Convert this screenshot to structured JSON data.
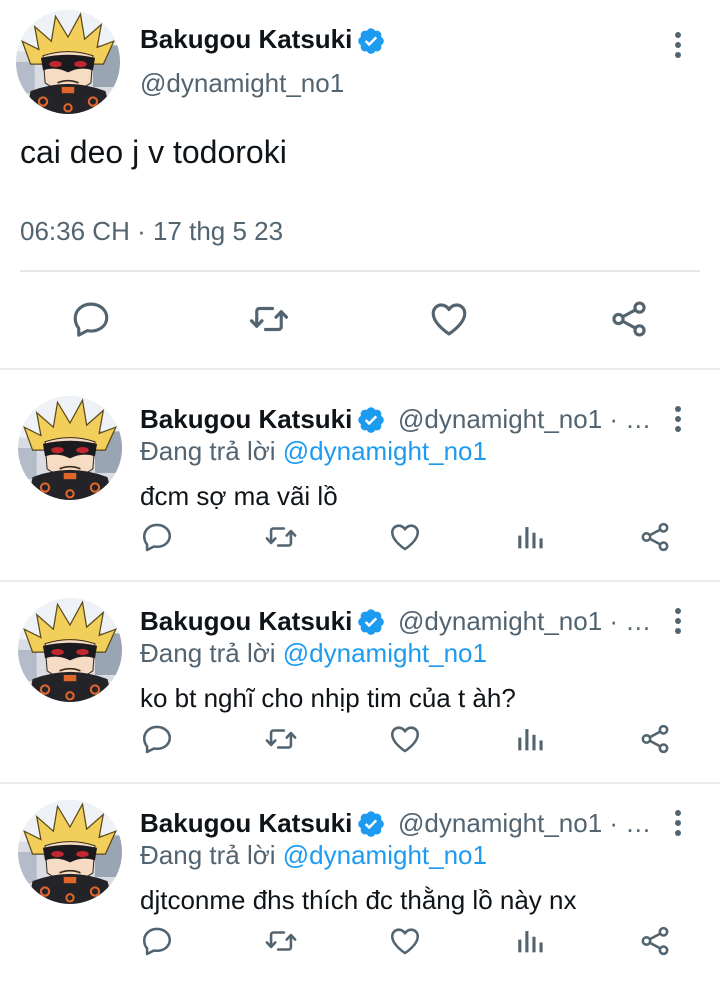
{
  "main_tweet": {
    "display_name": "Bakugou Katsuki",
    "handle": "@dynamight_no1",
    "text": "cai deo j v todoroki",
    "timestamp": "06:36 CH · 17 thg 5 23",
    "actions": [
      "reply-icon",
      "retweet-icon",
      "like-icon",
      "share-icon"
    ]
  },
  "replies": [
    {
      "display_name": "Bakugou Katsuki",
      "handle": "@dynamight_no1 · …",
      "replying_prefix": "Đang trả lời ",
      "replying_to": "@dynamight_no1",
      "text": "đcm sợ ma vãi lồ"
    },
    {
      "display_name": "Bakugou Katsuki",
      "handle": "@dynamight_no1 · …",
      "replying_prefix": "Đang trả lời ",
      "replying_to": "@dynamight_no1",
      "text": "ko bt nghĩ cho nhịp tim của t àh?"
    },
    {
      "display_name": "Bakugou Katsuki",
      "handle": "@dynamight_no1 · …",
      "replying_prefix": "Đang trả lời ",
      "replying_to": "@dynamight_no1",
      "text": "djtconme đhs thích đc thằng lồ này nx"
    }
  ],
  "reply_actions": [
    "reply-icon",
    "retweet-icon",
    "like-icon",
    "views-icon",
    "share-icon"
  ],
  "colors": {
    "text": "#0f1419",
    "secondary": "#536471",
    "accent": "#1d9bf0",
    "divider": "#e6e8ea"
  }
}
